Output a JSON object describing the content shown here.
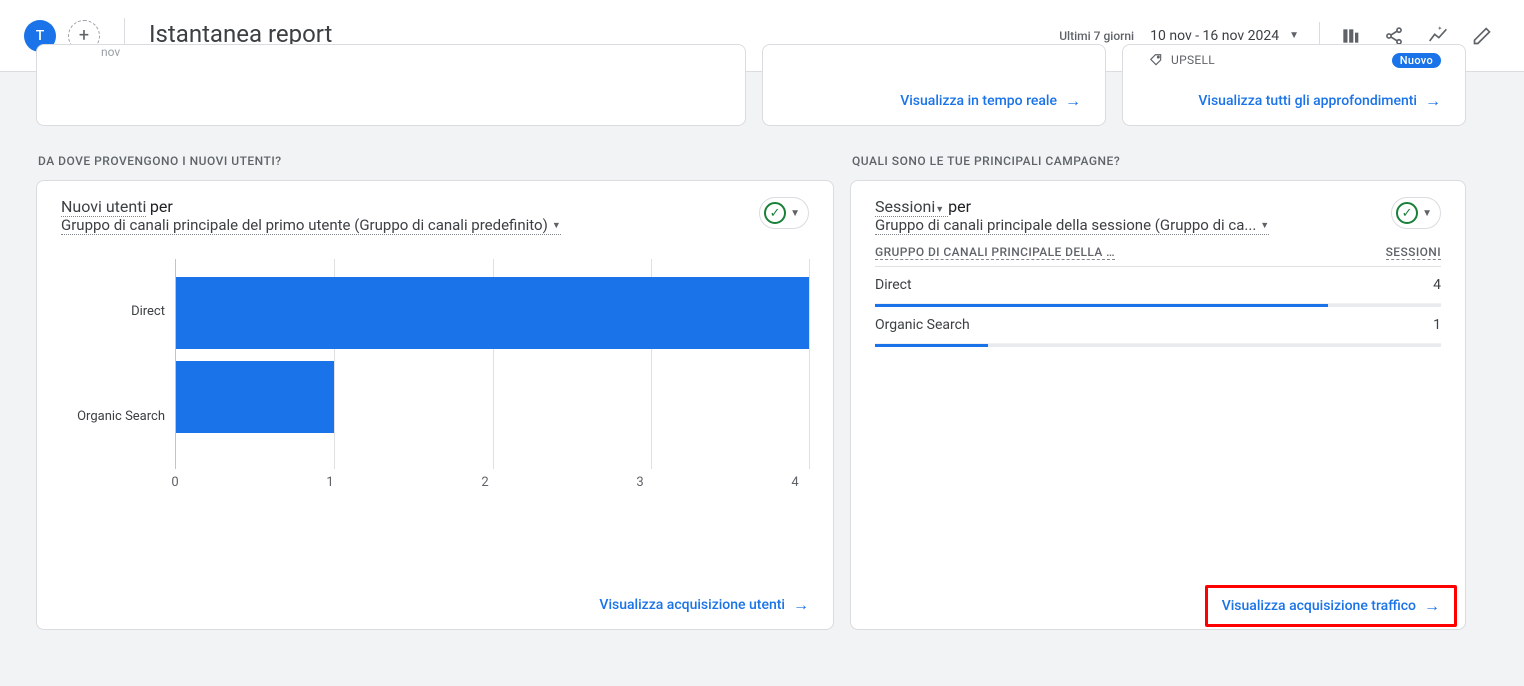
{
  "header": {
    "avatar_letter": "T",
    "page_title": "Istantanea report",
    "date_label": "Ultimi 7 giorni",
    "date_range": "10 nov - 16 nov 2024"
  },
  "top_cards": {
    "nov_text": "nov",
    "realtime_link": "Visualizza in tempo reale",
    "insights_tag": "UPSELL",
    "insights_badge": "Nuovo",
    "insights_link": "Visualizza tutti gli approfondimenti"
  },
  "section_left_title": "DA DOVE PROVENGONO I NUOVI UTENTI?",
  "section_right_title": "QUALI SONO LE TUE PRINCIPALI CAMPAGNE?",
  "left_card": {
    "metric": "Nuovi utenti",
    "per": " per",
    "dimension": "Gruppo di canali principale del primo utente (Gruppo di canali predefinito)",
    "link": "Visualizza acquisizione utenti"
  },
  "right_card": {
    "metric": "Sessioni",
    "per": " per",
    "dimension": "Gruppo di canali principale della sessione (Gruppo di ca...",
    "th_channel": "GRUPPO DI CANALI PRINCIPALE DELLA …",
    "th_value": "SESSIONI",
    "rows": [
      {
        "channel": "Direct",
        "value": "4",
        "progress_pct": 80
      },
      {
        "channel": "Organic Search",
        "value": "1",
        "progress_pct": 20
      }
    ],
    "link": "Visualizza acquisizione traffico"
  },
  "chart_data": {
    "type": "bar",
    "categories": [
      "Direct",
      "Organic Search"
    ],
    "values": [
      4,
      1
    ],
    "xlabel": "",
    "ylabel": "",
    "xlim": [
      0,
      4
    ],
    "ticks": [
      0,
      1,
      2,
      3,
      4
    ]
  }
}
